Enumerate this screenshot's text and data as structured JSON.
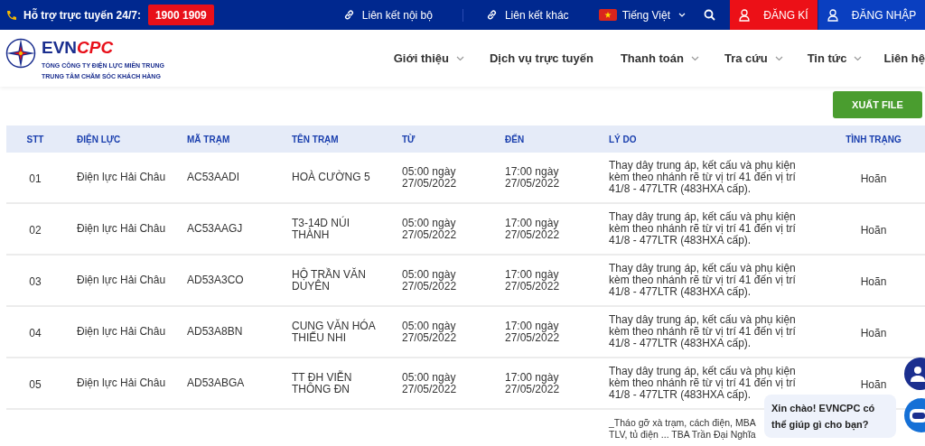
{
  "top_bar": {
    "support_label": "Hỗ trợ trực tuyến 24/7:",
    "hotline": "1900 1909",
    "links": [
      {
        "label": "Liên kết nội bộ"
      },
      {
        "label": "Liên kết khác"
      }
    ],
    "language": "Tiếng Việt",
    "buttons": [
      {
        "label": "ĐĂNG KÍ",
        "kind": "register"
      },
      {
        "label": "ĐĂNG NHẬP",
        "kind": "login"
      }
    ]
  },
  "logo": {
    "brand_a": "EVN",
    "brand_b": "CPC",
    "line_1": "TỔNG CÔNG TY ĐIỆN LỰC MIỀN TRUNG",
    "line_2": "TRUNG TÂM CHĂM SÓC KHÁCH HÀNG"
  },
  "nav": [
    {
      "label": "Giới thiệu",
      "has_dropdown": true
    },
    {
      "label": "Dịch vụ trực tuyến",
      "has_dropdown": false
    },
    {
      "label": "Thanh toán",
      "has_dropdown": true
    },
    {
      "label": "Tra cứu",
      "has_dropdown": true
    },
    {
      "label": "Tin tức",
      "has_dropdown": true
    },
    {
      "label": "Liên hệ",
      "has_dropdown": false
    }
  ],
  "export_button": "XUẤT FILE",
  "table": {
    "columns": [
      "STT",
      "ĐIỆN LỰC",
      "MÃ TRẠM",
      "TÊN TRẠM",
      "TỪ",
      "ĐẾN",
      "LÝ DO",
      "TÌNH TRẠNG"
    ],
    "rows": [
      {
        "stt": "01",
        "unit": "Điện lực Hải Châu",
        "code": "AC53AADI",
        "station": "HOÀ CƯỜNG 5",
        "from": "05:00 ngày 27/05/2022",
        "to": "17:00 ngày 27/05/2022",
        "reason": "Thay dây trung áp, kết cấu và phụ kiện kèm theo nhánh rẽ từ vị trí 41 đến vị trí 41/8 - 477LTR (483HXA cấp).",
        "status": "Hoãn"
      },
      {
        "stt": "02",
        "unit": "Điện lực Hải Châu",
        "code": "AC53AAGJ",
        "station": "T3-14D NÚI THÀNH",
        "from": "05:00 ngày 27/05/2022",
        "to": "17:00 ngày 27/05/2022",
        "reason": "Thay dây trung áp, kết cấu và phụ kiện kèm theo nhánh rẽ từ vị trí 41 đến vị trí 41/8 - 477LTR (483HXA cấp).",
        "status": "Hoãn"
      },
      {
        "stt": "03",
        "unit": "Điện lực Hải Châu",
        "code": "AD53A3CO",
        "station": "HỘ TRẦN VĂN DUYÊN",
        "from": "05:00 ngày 27/05/2022",
        "to": "17:00 ngày 27/05/2022",
        "reason": "Thay dây trung áp, kết cấu và phụ kiện kèm theo nhánh rẽ từ vị trí 41 đến vị trí 41/8 - 477LTR (483HXA cấp).",
        "status": "Hoãn"
      },
      {
        "stt": "04",
        "unit": "Điện lực Hải Châu",
        "code": "AD53A8BN",
        "station": "CUNG VĂN HÓA THIẾU NHI",
        "from": "05:00 ngày 27/05/2022",
        "to": "17:00 ngày 27/05/2022",
        "reason": "Thay dây trung áp, kết cấu và phụ kiện kèm theo nhánh rẽ từ vị trí 41 đến vị trí 41/8 - 477LTR (483HXA cấp).",
        "status": "Hoãn"
      },
      {
        "stt": "05",
        "unit": "Điện lực Hải Châu",
        "code": "AD53ABGA",
        "station": "TT ĐH VIỄN THÔNG ĐN",
        "from": "05:00 ngày 27/05/2022",
        "to": "17:00 ngày 27/05/2022",
        "reason": "Thay dây trung áp, kết cấu và phụ kiện kèm theo nhánh rẽ từ vị trí 41 đến vị trí 41/8 - 477LTR (483HXA cấp).",
        "status": "Hoãn"
      },
      {
        "reason_lines": [
          "_Tháo gỡ xà trạm, cách điện, MBA",
          "TLV, tủ điện ... TBA Trần Đại Nghĩa"
        ]
      }
    ]
  },
  "chat_bubble": "Xin chào! EVNCPC có thể giúp gì cho bạn?"
}
